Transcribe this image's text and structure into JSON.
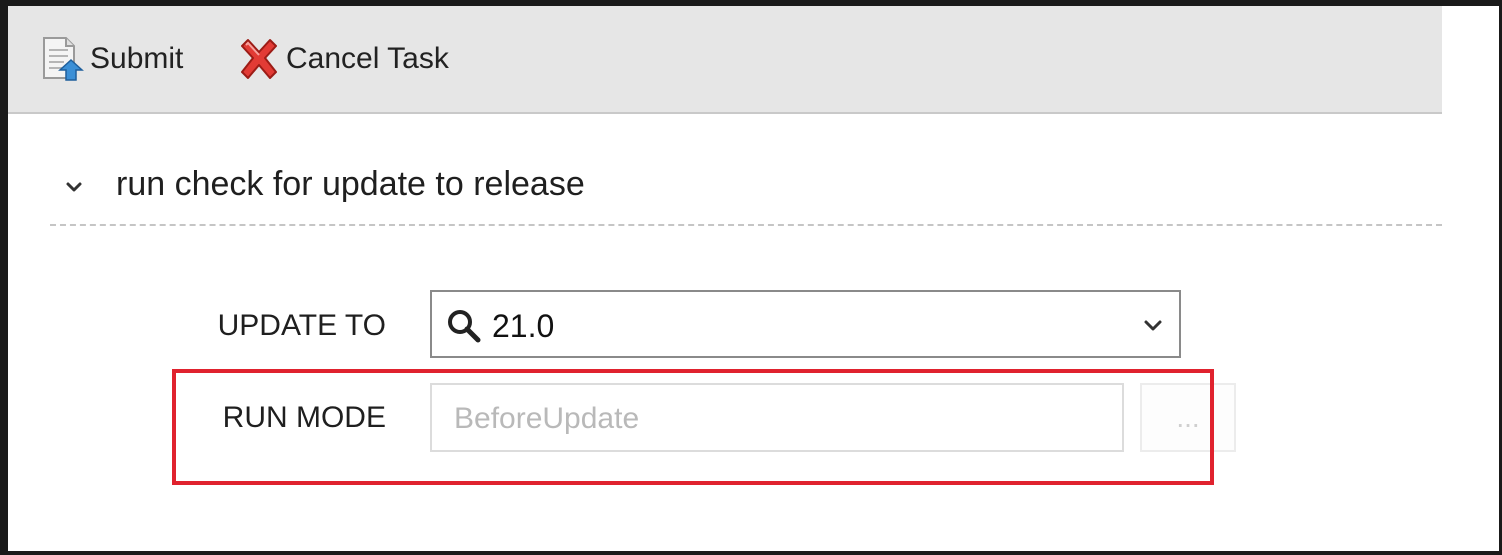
{
  "toolbar": {
    "submit_label": "Submit",
    "cancel_label": "Cancel Task",
    "submit_icon": "submit-document-icon",
    "cancel_icon": "red-x-icon"
  },
  "section": {
    "title": "run check for update to release",
    "expanded": true
  },
  "form": {
    "update_to": {
      "label": "UPDATE TO",
      "value": "21.0"
    },
    "run_mode": {
      "label": "RUN MODE",
      "placeholder": "BeforeUpdate",
      "button_label": "..."
    }
  },
  "colors": {
    "highlight": "#e0222e",
    "toolbar_bg": "#e6e6e6"
  }
}
